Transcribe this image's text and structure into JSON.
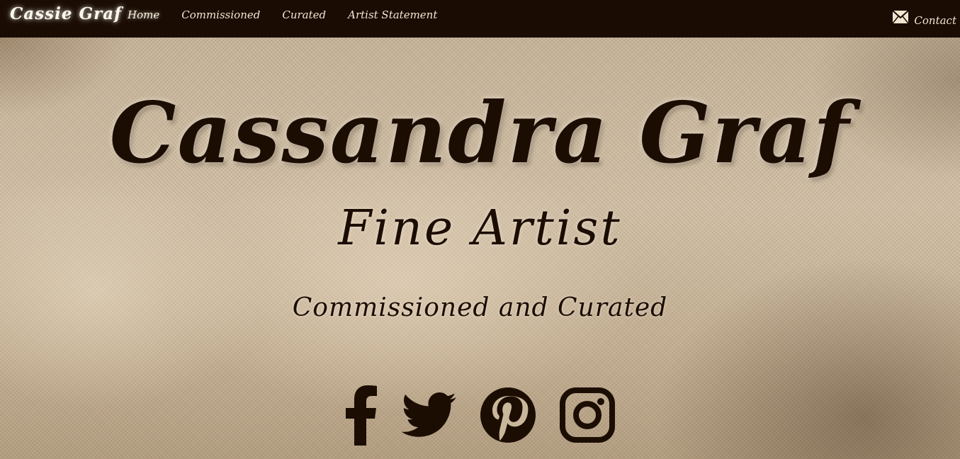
{
  "nav": {
    "brand": "Cassie Graf",
    "links": [
      {
        "label": "Home",
        "active": true
      },
      {
        "label": "Commissioned",
        "active": false
      },
      {
        "label": "Curated",
        "active": false
      },
      {
        "label": "Artist Statement",
        "active": false
      }
    ],
    "contact": {
      "label": "Contact",
      "icon": "envelope-icon"
    }
  },
  "hero": {
    "title": "Cassandra Graf",
    "subtitle": "Fine Artist",
    "tagline": "Commissioned and Curated",
    "social": [
      {
        "icon": "facebook-icon"
      },
      {
        "icon": "twitter-icon"
      },
      {
        "icon": "pinterest-icon"
      },
      {
        "icon": "instagram-icon"
      }
    ]
  },
  "colors": {
    "nav_bg": "#1a0c02",
    "nav_text": "#f2e6d2",
    "hero_text": "#1c0d03",
    "canvas": "#c7b49a"
  }
}
